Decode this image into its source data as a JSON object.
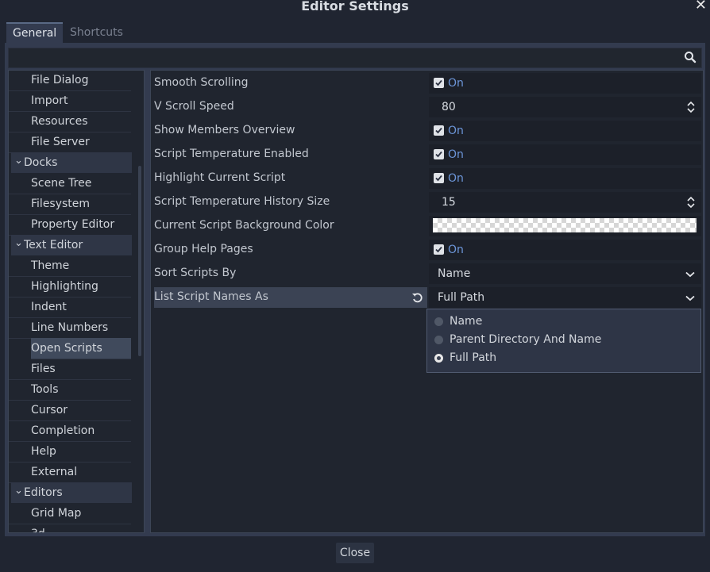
{
  "window": {
    "title": "Editor Settings"
  },
  "tabs": [
    {
      "label": "General"
    },
    {
      "label": "Shortcuts"
    }
  ],
  "search": {
    "placeholder": ""
  },
  "tree": {
    "items": [
      {
        "label": "File Dialog",
        "kind": "leaf"
      },
      {
        "label": "Import",
        "kind": "leaf"
      },
      {
        "label": "Resources",
        "kind": "leaf"
      },
      {
        "label": "File Server",
        "kind": "leaf"
      },
      {
        "label": "Docks",
        "kind": "category"
      },
      {
        "label": "Scene Tree",
        "kind": "leaf"
      },
      {
        "label": "Filesystem",
        "kind": "leaf"
      },
      {
        "label": "Property Editor",
        "kind": "leaf"
      },
      {
        "label": "Text Editor",
        "kind": "category"
      },
      {
        "label": "Theme",
        "kind": "leaf"
      },
      {
        "label": "Highlighting",
        "kind": "leaf"
      },
      {
        "label": "Indent",
        "kind": "leaf"
      },
      {
        "label": "Line Numbers",
        "kind": "leaf"
      },
      {
        "label": "Open Scripts",
        "kind": "leaf",
        "selected": true
      },
      {
        "label": "Files",
        "kind": "leaf"
      },
      {
        "label": "Tools",
        "kind": "leaf"
      },
      {
        "label": "Cursor",
        "kind": "leaf"
      },
      {
        "label": "Completion",
        "kind": "leaf"
      },
      {
        "label": "Help",
        "kind": "leaf"
      },
      {
        "label": "External",
        "kind": "leaf"
      },
      {
        "label": "Editors",
        "kind": "category"
      },
      {
        "label": "Grid Map",
        "kind": "leaf"
      },
      {
        "label": "3d",
        "kind": "leaf"
      }
    ]
  },
  "properties": [
    {
      "label": "Smooth Scrolling",
      "type": "bool",
      "value": "On"
    },
    {
      "label": "V Scroll Speed",
      "type": "number",
      "value": "80"
    },
    {
      "label": "Show Members Overview",
      "type": "bool",
      "value": "On"
    },
    {
      "label": "Script Temperature Enabled",
      "type": "bool",
      "value": "On"
    },
    {
      "label": "Highlight Current Script",
      "type": "bool",
      "value": "On"
    },
    {
      "label": "Script Temperature History Size",
      "type": "number",
      "value": "15"
    },
    {
      "label": "Current Script Background Color",
      "type": "color",
      "value": ""
    },
    {
      "label": "Group Help Pages",
      "type": "bool",
      "value": "On"
    },
    {
      "label": "Sort Scripts By",
      "type": "enum",
      "value": "Name"
    },
    {
      "label": "List Script Names As",
      "type": "enum",
      "value": "Full Path",
      "highlighted": true
    }
  ],
  "dropdown": {
    "options": [
      {
        "label": "Name",
        "selected": false
      },
      {
        "label": "Parent Directory And Name",
        "selected": false
      },
      {
        "label": "Full Path",
        "selected": true
      }
    ]
  },
  "footer": {
    "close_label": "Close"
  },
  "colors": {
    "accent": "#6c95d8",
    "panel": "#333b4f",
    "background": "#202531"
  }
}
